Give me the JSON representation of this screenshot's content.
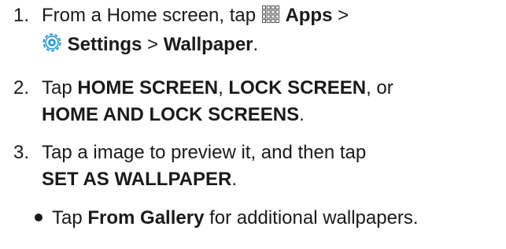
{
  "steps": [
    {
      "number": "1.",
      "line1": {
        "t1": "From a Home screen, tap ",
        "b1": "Apps",
        "t2": " >"
      },
      "line2": {
        "b1": "Settings",
        "t2": " > ",
        "b2": "Wallpaper",
        "t3": "."
      }
    },
    {
      "number": "2.",
      "line1": {
        "t1": "Tap ",
        "b1": "HOME SCREEN",
        "t2": ", ",
        "b2": "LOCK SCREEN",
        "t3": ", or"
      },
      "line2": {
        "b1": "HOME AND LOCK SCREENS",
        "t2": "."
      }
    },
    {
      "number": "3.",
      "line1": {
        "t1": "Tap a image to preview it, and then tap"
      },
      "line2": {
        "b1": "SET AS WALLPAPER",
        "t2": "."
      }
    }
  ],
  "bullet": {
    "t1": "Tap ",
    "b1": "From Gallery",
    "t2": " for additional wallpapers."
  },
  "icons": {
    "apps": "apps-grid-icon",
    "settings": "settings-gear-icon",
    "settings_color": "#2196d3"
  }
}
